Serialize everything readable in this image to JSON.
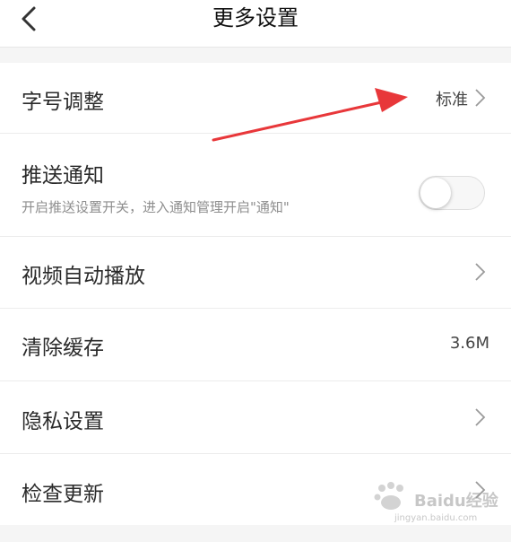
{
  "header": {
    "title": "更多设置",
    "back_icon": "chevron-left-icon"
  },
  "settings": {
    "font_size": {
      "label": "字号调整",
      "value": "标准"
    },
    "push": {
      "label": "推送通知",
      "description": "开启推送设置开关，进入通知管理开启\"通知\"",
      "enabled": false
    },
    "autoplay": {
      "label": "视频自动播放"
    },
    "cache": {
      "label": "清除缓存",
      "value": "3.6M"
    },
    "privacy": {
      "label": "隐私设置"
    },
    "update": {
      "label": "检查更新"
    }
  },
  "annotation": {
    "arrow_color": "#e8373a"
  },
  "watermark": {
    "brand": "Baidu",
    "text": "经验",
    "url": "jingyan.baidu.com"
  }
}
